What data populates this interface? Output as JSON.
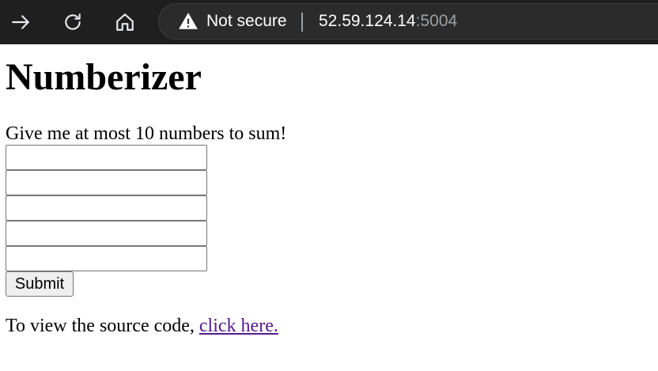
{
  "browser": {
    "security_status": "Not secure",
    "url_host": "52.59.124.14",
    "url_port": ":5004",
    "icons": {
      "forward": "arrow-right-icon",
      "reload": "reload-icon",
      "home": "home-icon",
      "security": "warning-triangle-icon"
    }
  },
  "page": {
    "title": "Numberizer",
    "instructions": "Give me at most 10 numbers to sum!",
    "inputs": [
      {
        "value": "",
        "placeholder": ""
      },
      {
        "value": "",
        "placeholder": ""
      },
      {
        "value": "",
        "placeholder": ""
      },
      {
        "value": "",
        "placeholder": ""
      },
      {
        "value": "",
        "placeholder": ""
      }
    ],
    "submit_label": "Submit",
    "source_prefix": "To view the source code, ",
    "source_link": "click here."
  },
  "colors": {
    "chrome_bg": "#1f1f1f",
    "omnibox_bg": "#2b2b2b",
    "visited_link": "#551a8b"
  }
}
